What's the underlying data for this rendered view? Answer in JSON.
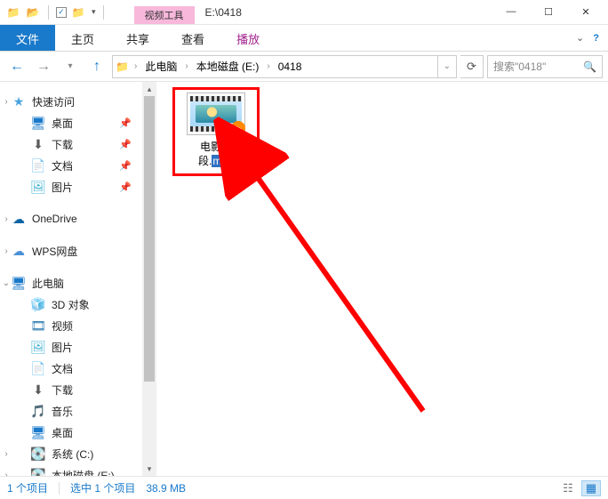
{
  "title_path": "E:\\0418",
  "context_tab_label": "视频工具",
  "ribbon": {
    "file": "文件",
    "home": "主页",
    "share": "共享",
    "view": "查看",
    "play": "播放"
  },
  "address": {
    "this_pc": "此电脑",
    "drive": "本地磁盘 (E:)",
    "folder": "0418"
  },
  "search_placeholder": "搜索\"0418\"",
  "nav": {
    "quick_access": "快速访问",
    "desktop": "桌面",
    "downloads": "下载",
    "documents": "文档",
    "pictures": "图片",
    "onedrive": "OneDrive",
    "wps": "WPS网盘",
    "this_pc": "此电脑",
    "objects3d": "3D 对象",
    "videos": "视频",
    "pictures2": "图片",
    "documents2": "文档",
    "downloads2": "下载",
    "music": "音乐",
    "desktop2": "桌面",
    "drive_c": "系统 (C:)",
    "drive_e": "本地磁盘 (E:)"
  },
  "file": {
    "name_line1": "电影片",
    "name_line2_prefix": "段.",
    "name_selected_ext": "m4v"
  },
  "status": {
    "count": "1 个项目",
    "selection": "选中 1 个项目",
    "size": "38.9 MB"
  }
}
